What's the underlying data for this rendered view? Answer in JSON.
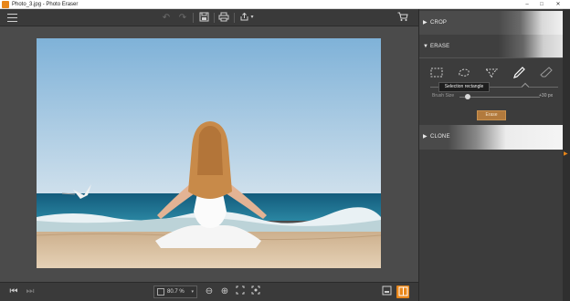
{
  "window": {
    "title": "Photo_3.jpg - Photo Eraser",
    "minimize": "–",
    "maximize": "□",
    "close": "✕"
  },
  "toolbar": {
    "icons": [
      "menu-icon",
      "undo-icon",
      "redo-icon",
      "save-icon",
      "print-icon",
      "share-icon",
      "cart-icon"
    ],
    "undo": "↶",
    "redo": "↷",
    "save": "💾",
    "print": "⎙",
    "share": "⇪",
    "share_caret": "▾",
    "cart": "🛒"
  },
  "canvas": {
    "sky_top": "#86b6da",
    "sky_bottom": "#c7dcea",
    "sea": "#1b6a8a",
    "sand": "#d9c2a3"
  },
  "statusbar": {
    "prev": "⏮",
    "next": "⏭",
    "zoom_value": "80.7 %",
    "zoom_caret": "▾",
    "zoom_out": "⊖",
    "zoom_in": "⊕",
    "fit": "⛶",
    "actual": "⛶",
    "compare": "⊟",
    "split": "◧"
  },
  "panel": {
    "crop": {
      "label": "CROP",
      "arrow": "▶"
    },
    "erase": {
      "label": "ERASE",
      "arrow": "▼"
    },
    "tools": [
      {
        "name": "selection-rectangle",
        "glyph": "⬚"
      },
      {
        "name": "lasso",
        "glyph": "◌"
      },
      {
        "name": "polygon-lasso",
        "glyph": "▽"
      },
      {
        "name": "brush",
        "glyph": "✎"
      },
      {
        "name": "eraser",
        "glyph": "✐"
      }
    ],
    "tooltip": "Selection rectangle",
    "brush_size_label": "Brush Size",
    "brush_size_value": "+30 px",
    "brush_size_px": 30,
    "erase_button": "Erase",
    "clone": {
      "label": "CLONE",
      "arrow": "▶"
    },
    "accent": "#e8861a"
  }
}
